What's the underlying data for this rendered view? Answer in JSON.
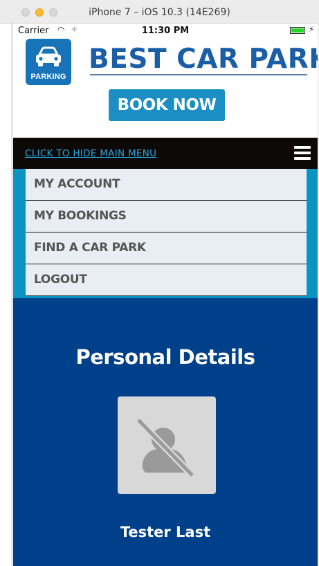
{
  "window": {
    "title": "iPhone 7 – iOS 10.3 (14E269)"
  },
  "status_bar": {
    "carrier": "Carrier",
    "wifi_icon": "wifi-icon",
    "time": "11:30 PM",
    "battery_icon": "battery-icon",
    "battery_level": 1.0
  },
  "header": {
    "logo_label": "PARKING",
    "logo_icon": "car-icon",
    "brand": "BEST CAR PARKS",
    "book_button": "BOOK NOW"
  },
  "menu_bar": {
    "toggle_label": "CLICK TO HIDE MAIN MENU",
    "hamburger_icon": "hamburger-icon"
  },
  "menu": {
    "items": [
      {
        "label": "MY ACCOUNT"
      },
      {
        "label": "MY BOOKINGS"
      },
      {
        "label": "FIND A CAR PARK"
      },
      {
        "label": "LOGOUT"
      }
    ]
  },
  "profile": {
    "title": "Personal Details",
    "avatar_icon": "no-photo-icon",
    "name": "Tester Last"
  },
  "colors": {
    "brand_blue": "#1b5ea8",
    "book_button": "#1b8ec4",
    "menu_accent": "#0a94c4",
    "content_background": "#003f8a",
    "menu_bar": "#0d0907"
  }
}
